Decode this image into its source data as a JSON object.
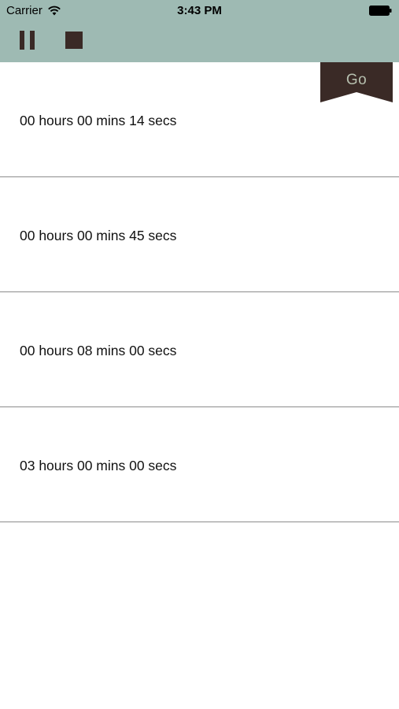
{
  "status_bar": {
    "carrier": "Carrier",
    "time": "3:43 PM",
    "wifi_icon": "wifi-icon",
    "battery_icon": "battery-icon"
  },
  "toolbar": {
    "pause_icon": "pause-icon",
    "stop_icon": "stop-icon",
    "go_label": "Go"
  },
  "timers": [
    {
      "label": "00 hours 00 mins 14 secs"
    },
    {
      "label": "00 hours 00 mins 45 secs"
    },
    {
      "label": "00 hours 08 mins 00 secs"
    },
    {
      "label": "03 hours 00 mins 00 secs"
    }
  ],
  "colors": {
    "header_bg": "#9ebab3",
    "accent_dark": "#3a2a26",
    "go_text": "#b6bfae",
    "divider": "#8c8c8c"
  }
}
